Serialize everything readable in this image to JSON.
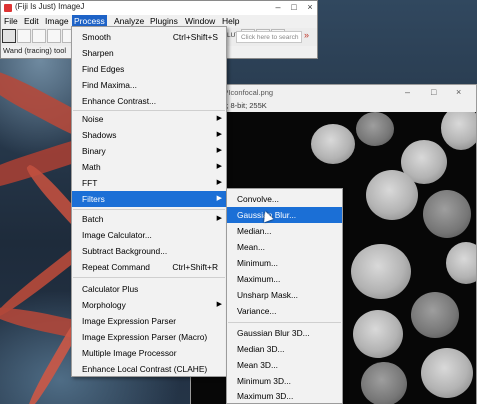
{
  "ij_window": {
    "title": "(Fiji Is Just) ImageJ",
    "menus": [
      "File",
      "Edit",
      "Image",
      "Process",
      "Analyze",
      "Plugins",
      "Window",
      "Help"
    ],
    "active_menu": "Process",
    "search_placeholder": "Click here to search",
    "status": "Wand (tracing) tool",
    "tool_label": "LUT"
  },
  "image_window": {
    "title": "DAPIconfocal.png",
    "info": "xels; 8-bit; 255K"
  },
  "process_menu": {
    "items": [
      {
        "label": "Smooth",
        "shortcut": "Ctrl+Shift+S"
      },
      {
        "label": "Sharpen"
      },
      {
        "label": "Find Edges"
      },
      {
        "label": "Find Maxima..."
      },
      {
        "label": "Enhance Contrast..."
      },
      {
        "label": "Noise",
        "submenu": true
      },
      {
        "label": "Shadows",
        "submenu": true
      },
      {
        "label": "Binary",
        "submenu": true
      },
      {
        "label": "Math",
        "submenu": true
      },
      {
        "label": "FFT",
        "submenu": true
      },
      {
        "label": "Filters",
        "submenu": true,
        "highlighted": true
      },
      {
        "label": "Batch",
        "submenu": true
      },
      {
        "label": "Image Calculator..."
      },
      {
        "label": "Subtract Background..."
      },
      {
        "label": "Repeat Command",
        "shortcut": "Ctrl+Shift+R"
      },
      {
        "label": "Calculator Plus"
      },
      {
        "label": "Morphology",
        "submenu": true
      },
      {
        "label": "Image Expression Parser"
      },
      {
        "label": "Image Expression Parser (Macro)"
      },
      {
        "label": "Multiple Image Processor"
      },
      {
        "label": "Enhance Local Contrast (CLAHE)"
      }
    ]
  },
  "filters_menu": {
    "items": [
      {
        "label": "Convolve..."
      },
      {
        "label": "Gaussian Blur...",
        "highlighted": true
      },
      {
        "label": "Median..."
      },
      {
        "label": "Mean..."
      },
      {
        "label": "Minimum..."
      },
      {
        "label": "Maximum..."
      },
      {
        "label": "Unsharp Mask..."
      },
      {
        "label": "Variance..."
      },
      {
        "label": "Gaussian Blur 3D..."
      },
      {
        "label": "Median 3D..."
      },
      {
        "label": "Mean 3D..."
      },
      {
        "label": "Minimum 3D..."
      },
      {
        "label": "Maximum 3D..."
      }
    ]
  },
  "colors": {
    "menu_highlight": "#1b6fd6",
    "menu_background": "#f2f2f2"
  }
}
